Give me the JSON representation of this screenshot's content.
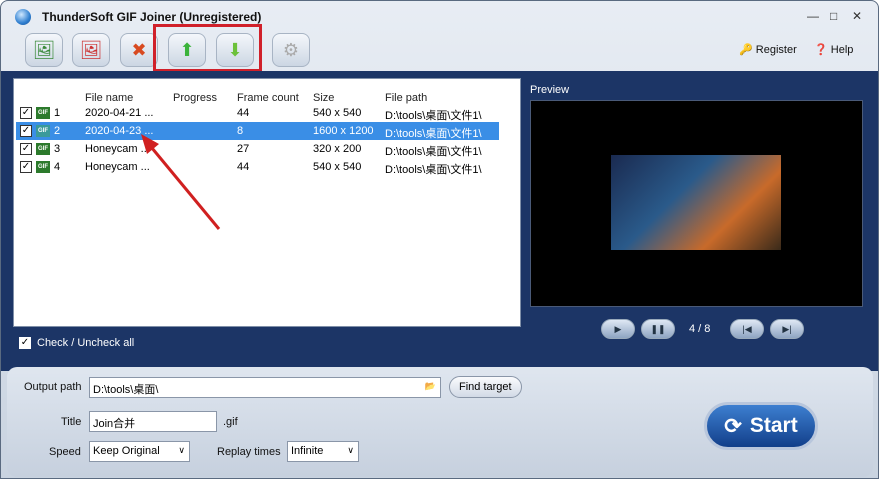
{
  "window": {
    "title": "ThunderSoft GIF Joiner (Unregistered)",
    "minimize": "—",
    "maximize": "□",
    "close": "✕"
  },
  "toolbar": {
    "add_icon": "🖼",
    "remove_icon": "🖼",
    "clear_icon": "✖",
    "up_icon": "⬆",
    "down_icon": "⬇",
    "settings_icon": "⚙",
    "register": "Register",
    "help": "Help"
  },
  "list": {
    "columns": [
      "File name",
      "Progress",
      "Frame count",
      "Size",
      "File path"
    ],
    "rows": [
      {
        "index": "1",
        "name": "2020-04-21 ...",
        "progress": "",
        "frames": "44",
        "size": "540 x 540",
        "path": "D:\\tools\\桌面\\文件1\\"
      },
      {
        "index": "2",
        "name": "2020-04-23 ...",
        "progress": "",
        "frames": "8",
        "size": "1600 x 1200",
        "path": "D:\\tools\\桌面\\文件1\\"
      },
      {
        "index": "3",
        "name": "Honeycam ...",
        "progress": "",
        "frames": "27",
        "size": "320 x 200",
        "path": "D:\\tools\\桌面\\文件1\\"
      },
      {
        "index": "4",
        "name": "Honeycam ...",
        "progress": "",
        "frames": "44",
        "size": "540 x 540",
        "path": "D:\\tools\\桌面\\文件1\\"
      }
    ],
    "check_all": "Check / Uncheck all"
  },
  "preview": {
    "label": "Preview",
    "frame_counter": "4 / 8"
  },
  "output": {
    "path_label": "Output path",
    "path_value": "D:\\tools\\桌面\\",
    "find_target": "Find target",
    "title_label": "Title",
    "title_value": "Join合并",
    "ext": ".gif",
    "speed_label": "Speed",
    "speed_value": "Keep Original",
    "replay_label": "Replay times",
    "replay_value": "Infinite",
    "start": "Start"
  }
}
